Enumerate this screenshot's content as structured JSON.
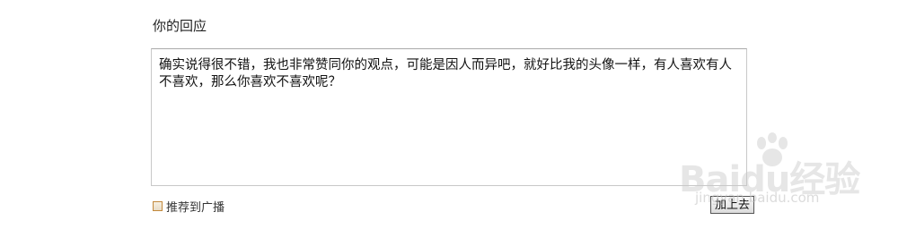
{
  "reply": {
    "title": "你的回应",
    "content": "确实说得很不错，我也非常赞同你的观点，可能是因人而异吧，就好比我的头像一样，有人喜欢有人不喜欢，那么你喜欢不喜欢呢？"
  },
  "share": {
    "label": "推荐到广播",
    "checked": false
  },
  "submit": {
    "label": "加上去"
  },
  "watermark": {
    "logo_text": "Baidu经验",
    "sub_text": "jingyan.baidu.com"
  }
}
